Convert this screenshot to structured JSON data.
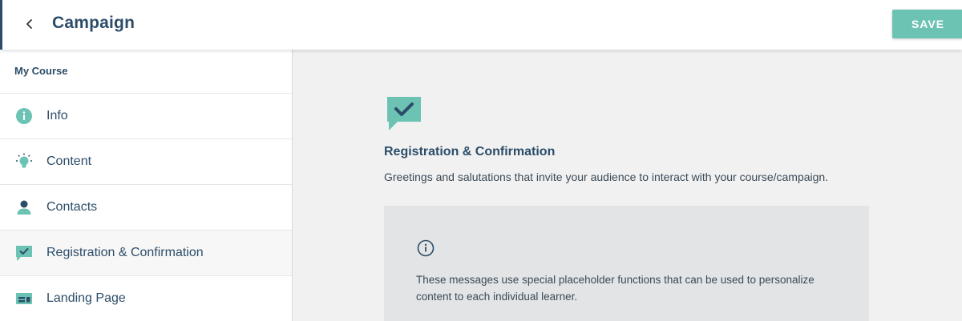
{
  "header": {
    "title": "Campaign",
    "save_label": "SAVE"
  },
  "sidebar": {
    "heading": "My Course",
    "items": [
      {
        "label": "Info",
        "icon": "info-icon"
      },
      {
        "label": "Content",
        "icon": "lightbulb-icon"
      },
      {
        "label": "Contacts",
        "icon": "person-icon"
      },
      {
        "label": "Registration & Confirmation",
        "icon": "chat-check-icon",
        "active": true
      },
      {
        "label": "Landing Page",
        "icon": "landing-page-icon"
      }
    ]
  },
  "main": {
    "icon": "chat-check-icon",
    "title": "Registration & Confirmation",
    "description": "Greetings and salutations that invite your audience to interact with your course/campaign.",
    "info_box": {
      "icon": "info-outline-icon",
      "text": "These messages use special placeholder functions that can be used to personalize content to each individual learner."
    }
  },
  "colors": {
    "brand_navy": "#2c4d69",
    "accent_teal": "#6cc3b3",
    "background": "#f1f1f1",
    "info_box": "#e3e4e5"
  }
}
